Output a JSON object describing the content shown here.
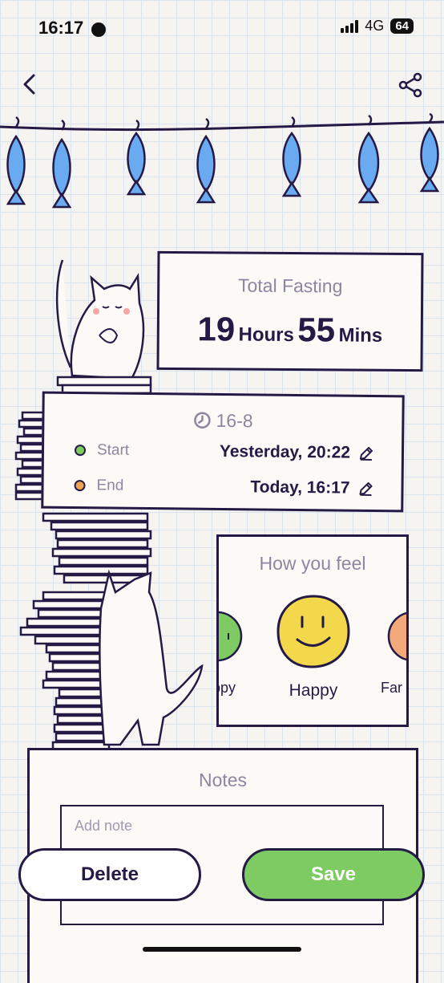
{
  "status_bar": {
    "time": "16:17",
    "network": "4G",
    "battery": "64"
  },
  "summary": {
    "title": "Total Fasting",
    "hours": "19",
    "hours_unit": "Hours",
    "minutes": "55",
    "minutes_unit": "Mins"
  },
  "schedule": {
    "plan": "16-8",
    "start_label": "Start",
    "start_value": "Yesterday, 20:22",
    "end_label": "End",
    "end_value": "Today, 16:17"
  },
  "mood": {
    "title": "How you feel",
    "prev_label": "ppy",
    "selected_label": "Happy",
    "next_label": "Far"
  },
  "notes": {
    "title": "Notes",
    "placeholder": "Add note"
  },
  "actions": {
    "delete": "Delete",
    "save": "Save"
  },
  "colors": {
    "accent_green": "#7ecb63",
    "ink": "#241a45",
    "muted": "#8c86a1",
    "fish_blue": "#6aaaf0"
  }
}
